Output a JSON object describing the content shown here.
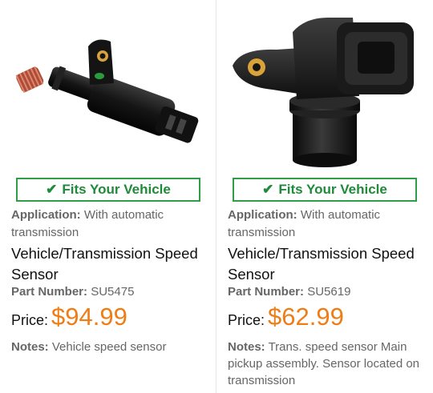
{
  "products": [
    {
      "image": "speed-sensor-photo",
      "fits_label": "Fits Your Vehicle",
      "application_label": "Application:",
      "application_value": "With automatic transmission",
      "title": "Vehicle/Transmission Speed Sensor",
      "part_label": "Part Number:",
      "part_value": "SU5475",
      "price_label": "Price:",
      "price_value": "$94.99",
      "notes_label": "Notes:",
      "notes_value": "Vehicle speed sensor"
    },
    {
      "image": "speed-sensor-photo",
      "fits_label": "Fits Your Vehicle",
      "application_label": "Application:",
      "application_value": "With automatic transmission",
      "title": "Vehicle/Transmission Speed Sensor",
      "part_label": "Part Number:",
      "part_value": "SU5619",
      "price_label": "Price:",
      "price_value": "$62.99",
      "notes_label": "Notes:",
      "notes_value": "Trans. speed sensor Main pickup assembly. Sensor located on transmission"
    }
  ],
  "colors": {
    "fits_green": "#2e9d47",
    "price_orange": "#ee7d16",
    "label_gray": "#666666"
  },
  "icons": {
    "fits": "check-icon"
  }
}
